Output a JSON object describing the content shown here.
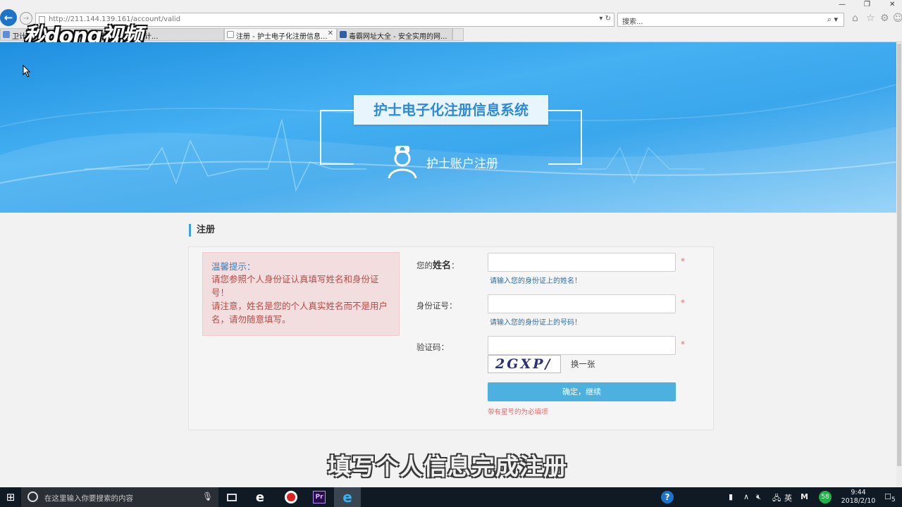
{
  "browser": {
    "url": "http://211.144.139.161/account/valid",
    "search_placeholder": "搜索...",
    "tabs": [
      {
        "label": "卫计..."
      },
      {
        "label": "共和国国家卫生和计..."
      },
      {
        "label": "注册 - 护士电子化注册信息..."
      },
      {
        "label": "毒霸网址大全 - 安全实用的网..."
      }
    ]
  },
  "watermark_logo": "秒dong视频",
  "banner": {
    "system_title": "护士电子化注册信息系统",
    "page_title": "护士账户注册"
  },
  "section": {
    "title": "注册"
  },
  "notice": {
    "title": "温馨提示：",
    "line1": "请您参照个人身份证认真填写姓名和身份证号！",
    "line2": "请注意，姓名是您的个人真实姓名而不是用户名，请勿随意填写。"
  },
  "form": {
    "name_label_prefix": "您的",
    "name_label_main": "姓名",
    "name_label_suffix": "：",
    "name_value": "",
    "name_hint": "请输入您的身份证上的姓名！",
    "id_label": "身份证号：",
    "id_value": "",
    "id_hint": "请输入您的身份证上的号码！",
    "captcha_label": "验证码：",
    "captcha_value": "",
    "captcha_text": "2GXP/",
    "captcha_refresh": "换一张",
    "required_mark": "*",
    "submit": "确定，继续",
    "required_note": "带有星号的为必填项"
  },
  "video_subtitle": "填写个人信息完成注册",
  "taskbar": {
    "search_placeholder": "在这里输入你要搜索的内容",
    "ime": "英",
    "badge": "58",
    "time": "9:44",
    "date": "2018/2/10",
    "notify_count": "5"
  },
  "colors": {
    "accent": "#4db1e0",
    "banner": "#3aa6ec",
    "notice_bg": "#f2dede",
    "required": "#e07070"
  }
}
